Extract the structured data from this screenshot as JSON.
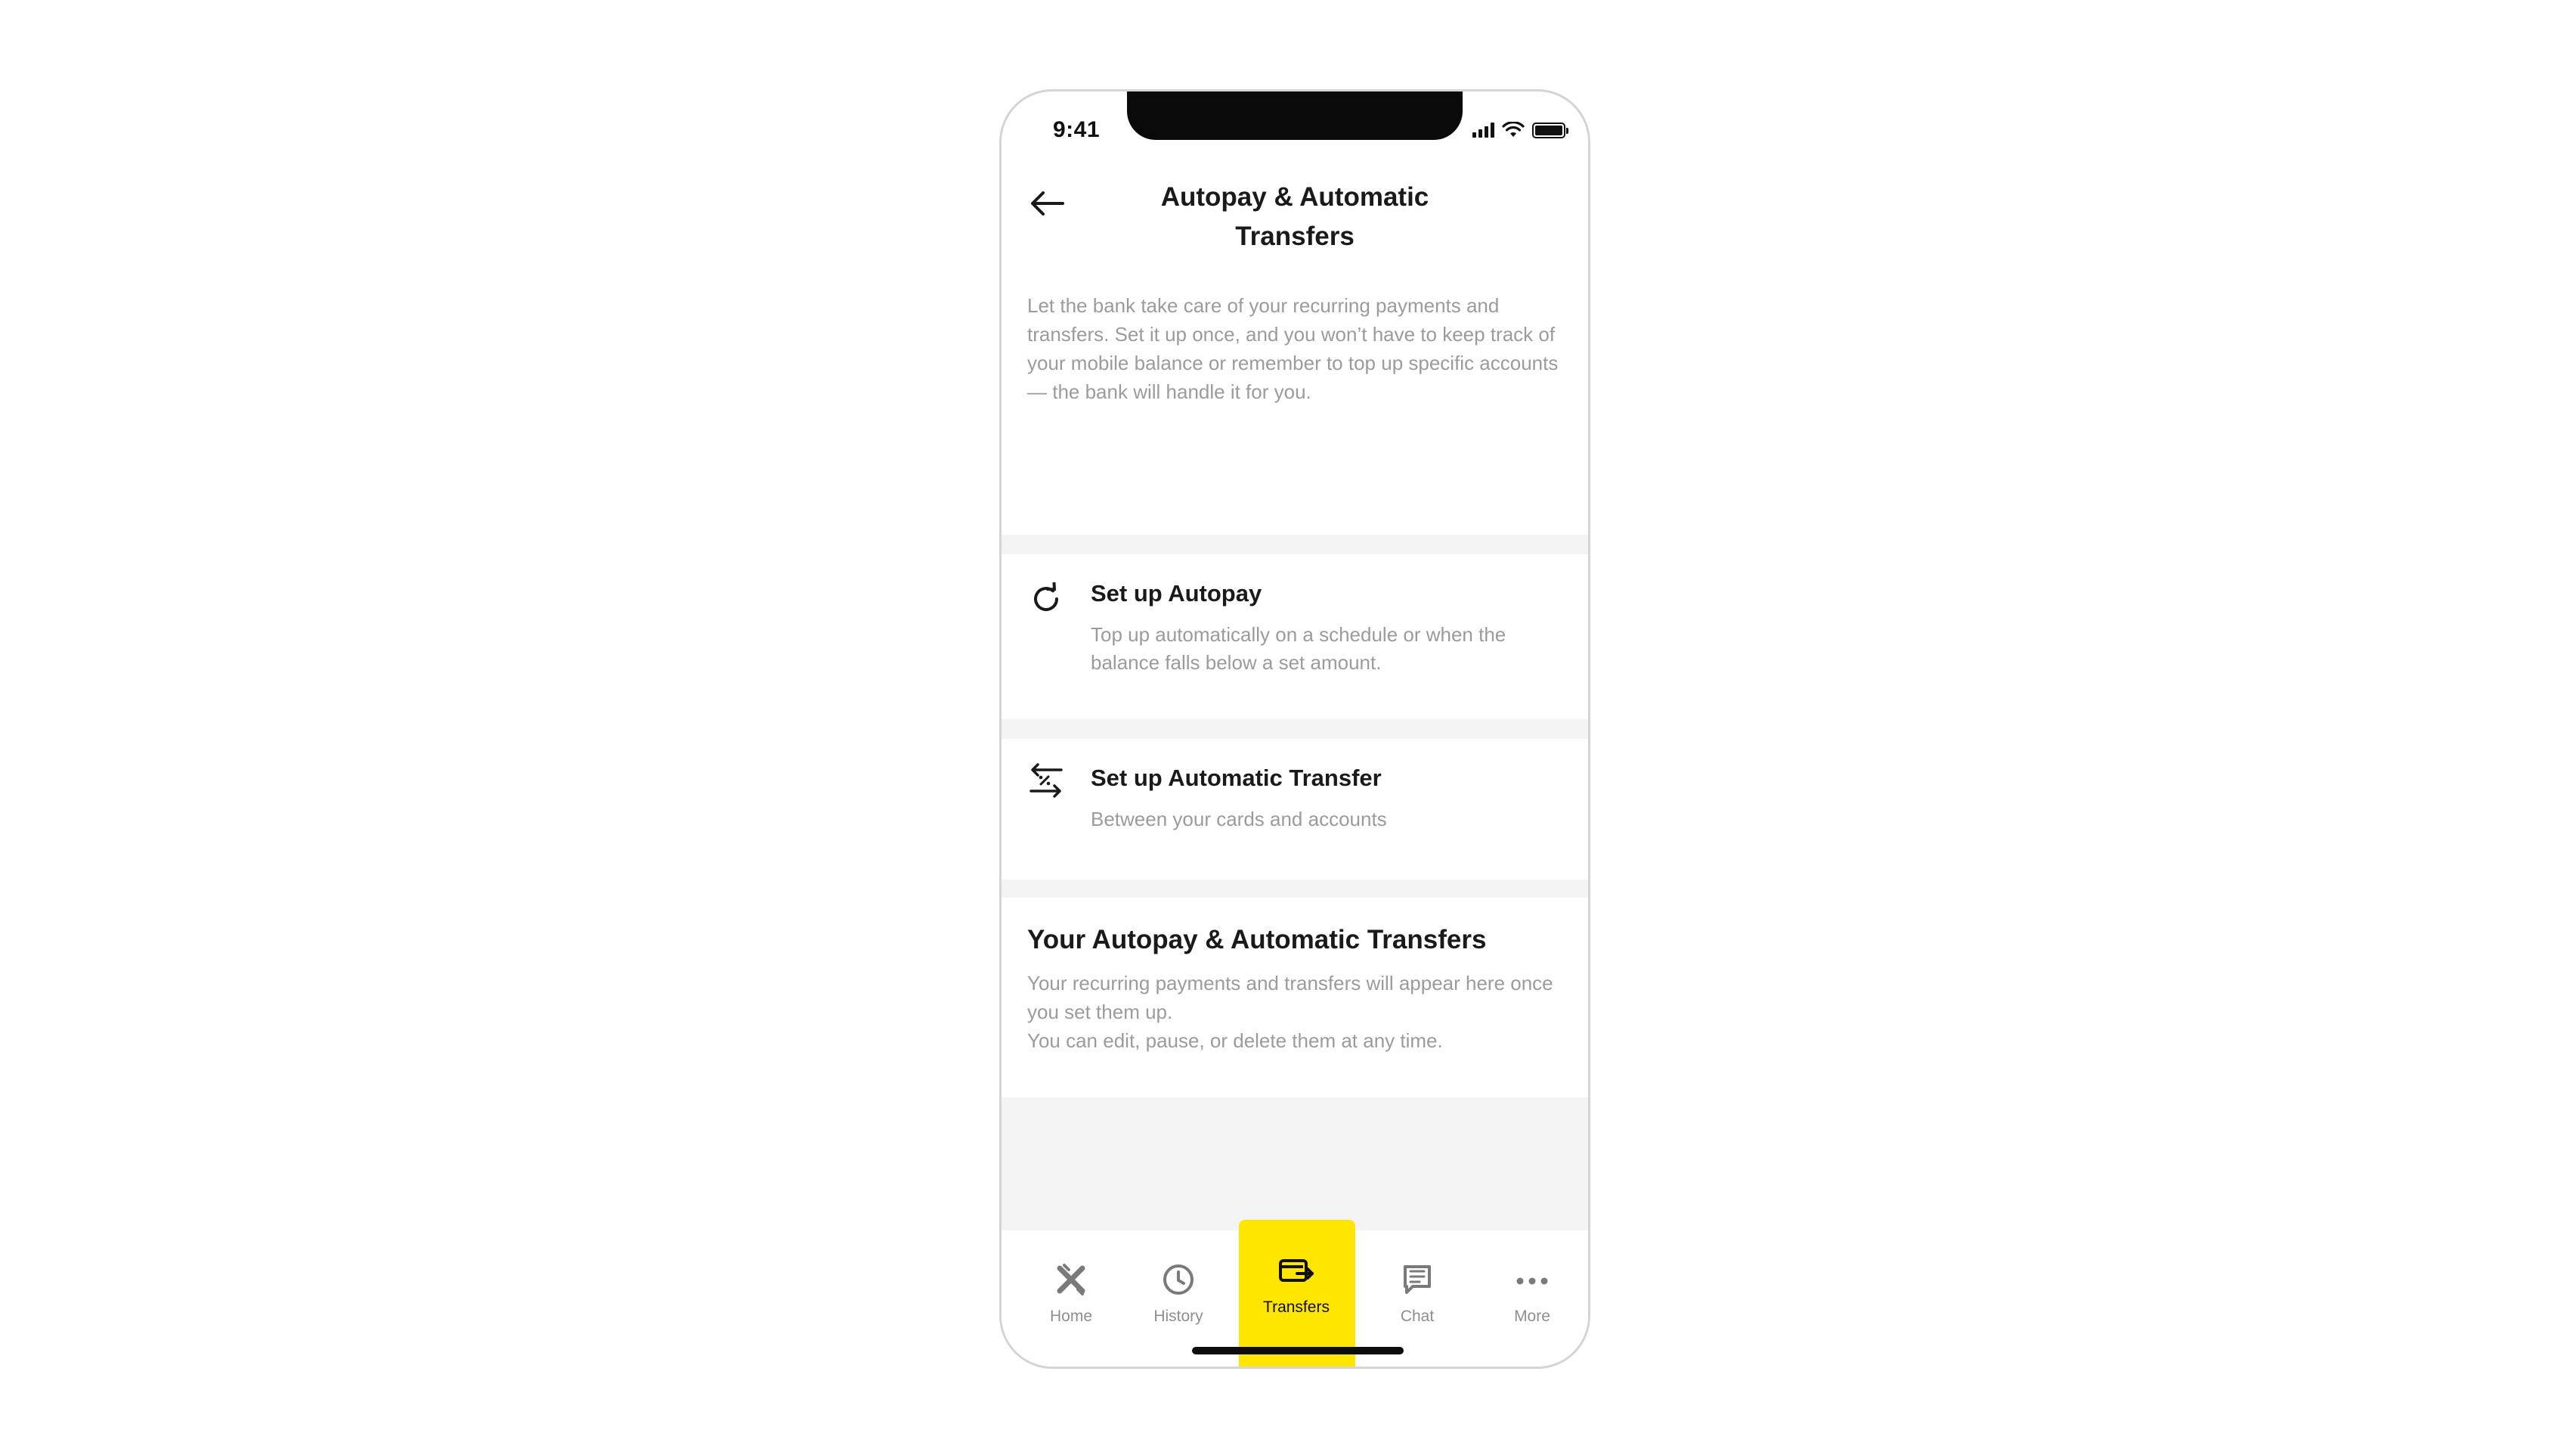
{
  "status_bar": {
    "time": "9:41"
  },
  "header": {
    "title": "Autopay & Automatic Transfers",
    "intro": "Let the bank take care of your recurring payments and transfers. Set it up once, and you won’t have to keep track of your mobile balance or remember to top up specific accounts — the bank will handle it for you."
  },
  "options": [
    {
      "title": "Set up Autopay",
      "description": "Top up automatically on a schedule or when the balance falls below a set amount.",
      "icon": "refresh-icon"
    },
    {
      "title": "Set up Automatic Transfer",
      "description": "Between your cards and accounts",
      "icon": "transfer-arrows-icon"
    }
  ],
  "my_list": {
    "title": "Your Autopay & Automatic Transfers",
    "line1": "Your recurring payments and transfers will appear here once you set them up.",
    "line2": "You can edit, pause, or delete them at any time."
  },
  "tab_bar": {
    "active": "Transfers",
    "accent_color": "#ffe600",
    "tabs": [
      {
        "label": "Home",
        "icon": "home-logo-icon"
      },
      {
        "label": "History",
        "icon": "clock-icon"
      },
      {
        "label": "Transfers",
        "icon": "transfer-card-icon"
      },
      {
        "label": "Chat",
        "icon": "chat-icon"
      },
      {
        "label": "More",
        "icon": "more-dots-icon"
      }
    ]
  }
}
